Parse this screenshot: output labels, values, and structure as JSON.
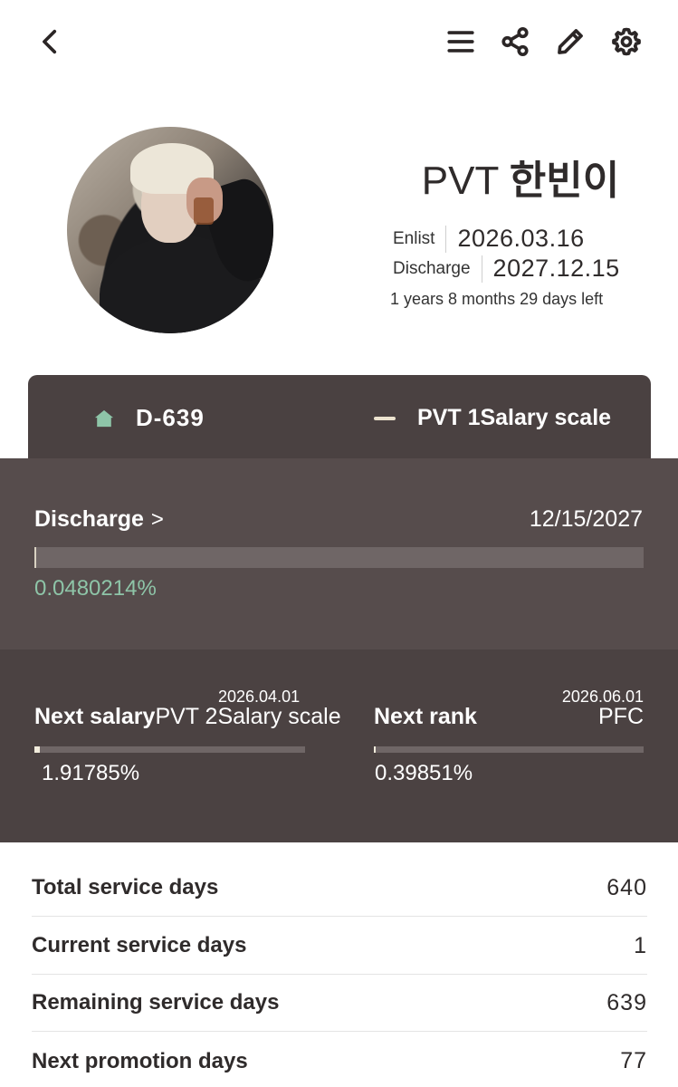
{
  "topbar": {
    "back_icon": "chevron-left-icon",
    "menu_icon": "hamburger-menu-icon",
    "share_icon": "share-icon",
    "edit_icon": "pencil-icon",
    "settings_icon": "gear-icon"
  },
  "profile": {
    "rank": "PVT",
    "name": "한빈이",
    "enlist_label": "Enlist",
    "enlist_date": "2026.03.16",
    "discharge_label": "Discharge",
    "discharge_date": "2027.12.15",
    "time_left": "1 years 8 months 29 days left"
  },
  "dday_card": {
    "dday": "D-639",
    "salary_scale": "PVT 1Salary scale",
    "colors": {
      "card": "#4a4141",
      "house": "#8ec5a8",
      "dash": "#ece3cf"
    }
  },
  "discharge": {
    "label": "Discharge",
    "chevron": ">",
    "date": "12/15/2027",
    "progress_text": "0.0480214%",
    "progress_fraction": 0.000480214,
    "colors": {
      "bg": "#564c4c",
      "percent": "#8ec5a8"
    }
  },
  "next_salary": {
    "date": "2026.04.01",
    "label": "Next salary",
    "value": "PVT 2Salary scale",
    "progress_text": "1.91785%",
    "progress_fraction": 0.0191785
  },
  "next_rank": {
    "date": "2026.06.01",
    "label": "Next rank",
    "value": "PFC",
    "progress_text": "0.39851%",
    "progress_fraction": 0.0039851
  },
  "stats": [
    {
      "label": "Total service days",
      "value": "640"
    },
    {
      "label": "Current service days",
      "value": "1"
    },
    {
      "label": "Remaining service days",
      "value": "639"
    },
    {
      "label": "Next promotion days",
      "value": "77"
    }
  ]
}
